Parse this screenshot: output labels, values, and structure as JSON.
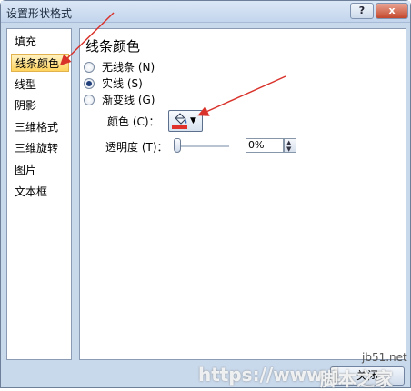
{
  "window": {
    "title": "设置形状格式"
  },
  "titlebar": {
    "help_label": "?",
    "close_label": "x"
  },
  "sidebar": {
    "items": [
      {
        "label": "填充",
        "selected": false
      },
      {
        "label": "线条颜色",
        "selected": true
      },
      {
        "label": "线型",
        "selected": false
      },
      {
        "label": "阴影",
        "selected": false
      },
      {
        "label": "三维格式",
        "selected": false
      },
      {
        "label": "三维旋转",
        "selected": false
      },
      {
        "label": "图片",
        "selected": false
      },
      {
        "label": "文本框",
        "selected": false
      }
    ]
  },
  "panel": {
    "title": "线条颜色",
    "options": [
      {
        "label": "无线条 (N)",
        "checked": false
      },
      {
        "label": "实线 (S)",
        "checked": true
      },
      {
        "label": "渐变线 (G)",
        "checked": false
      }
    ],
    "color_label": "颜色 (C)：",
    "color_value": "#e0312a",
    "color_icon": "paint-bucket-icon",
    "transparency_label": "透明度 (T)：",
    "transparency_value": "0%",
    "transparency_fraction": 0
  },
  "footer": {
    "close_label": "关闭"
  },
  "watermark": {
    "site": "jb51.net",
    "url": "https://www.1",
    "brand": "脚本之家"
  },
  "colors": {
    "arrow": "#d9322b",
    "selection": "#ffd35e",
    "frame": "#c9d9ec"
  }
}
